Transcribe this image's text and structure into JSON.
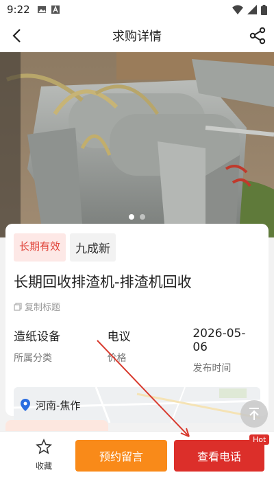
{
  "status_bar": {
    "time": "9:22"
  },
  "nav": {
    "title": "求购详情"
  },
  "carousel": {
    "pages": 2,
    "active": 1
  },
  "detail": {
    "tags": [
      "长期有效",
      "九成新"
    ],
    "title": "长期回收排渣机-排渣机回收",
    "copy_label": "复制标题",
    "meta": [
      {
        "value": "造纸设备",
        "label": "所属分类"
      },
      {
        "value": "电议",
        "label": "价格"
      },
      {
        "value": "2026-05-06",
        "label": "发布时间"
      }
    ],
    "location": "河南-焦作"
  },
  "bottom_bar": {
    "favorite_label": "收藏",
    "reserve_label": "预约留言",
    "call_label": "查看电话",
    "hot_badge": "Hot"
  },
  "colors": {
    "accent_red": "#dc2f2a",
    "accent_orange": "#f98a19"
  }
}
